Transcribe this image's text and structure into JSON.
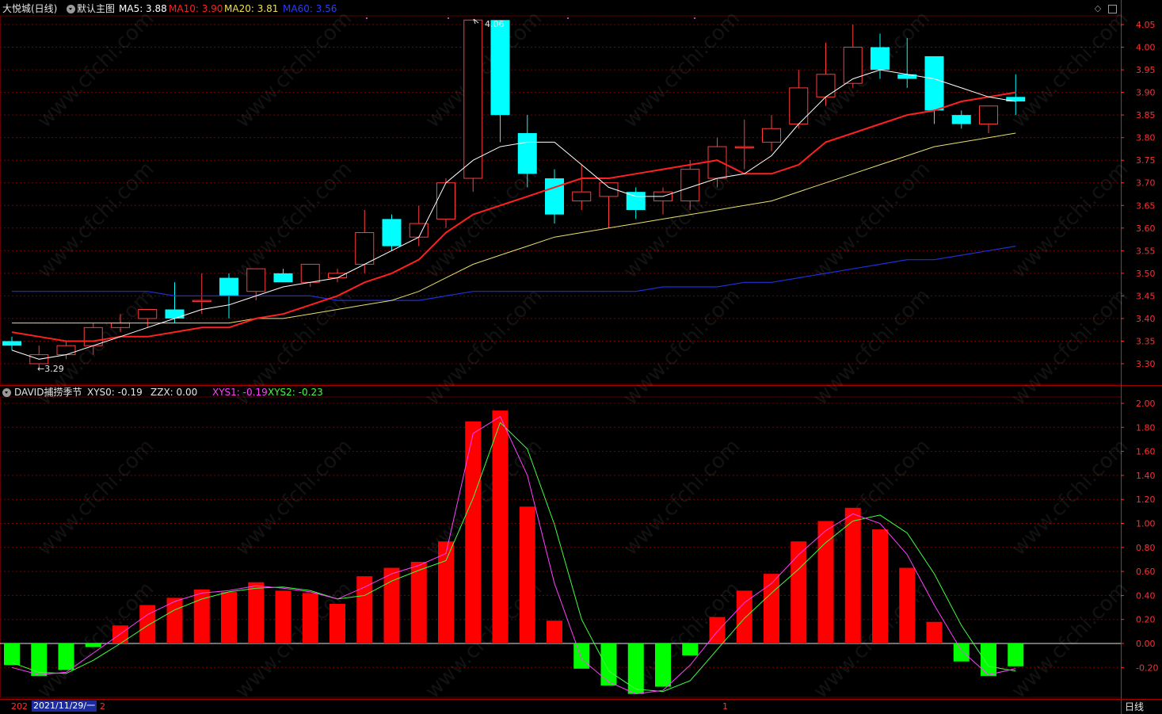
{
  "title_bar": {
    "stock_label": "大悦城(日线)",
    "main_chart_label": "默认主图",
    "ma5": "MA5: 3.88",
    "ma10": "MA10: 3.90",
    "ma20": "MA20: 3.81",
    "ma60": "MA60: 3.56"
  },
  "indicator_bar": {
    "name": "DAVID捕捞季节",
    "xys0": "XYS0: -0.19",
    "zzx": "ZZX: 0.00",
    "xys1": "XYS1: -0.19",
    "xys2": "XYS2: -0.23"
  },
  "annotations": {
    "low": "←3.29",
    "high": "4.06"
  },
  "bottom": {
    "left_year": "202",
    "date_cursor": "2021/11/29/一",
    "after_cursor": "2",
    "mid_marker": "1",
    "period_button": "日线"
  },
  "watermark": "www.cfchi.com",
  "colors": {
    "up": "#ff3c3c",
    "down": "#00ffff",
    "ma5": "#ffffff",
    "ma10": "#ff2020",
    "ma20": "#e8e070",
    "ma60": "#1f2fd8",
    "bar_up": "#ff0000",
    "bar_down": "#00ff00",
    "xys1": "#ff40ff",
    "xys2": "#40ff40",
    "grid": "#7a0000",
    "axis": "#ff3030"
  },
  "chart_data": [
    {
      "type": "candlestick",
      "price_axis_ticks": [
        "4.05",
        "4.00",
        "3.95",
        "3.90",
        "3.85",
        "3.80",
        "3.75",
        "3.70",
        "3.65",
        "3.60",
        "3.55",
        "3.50",
        "3.45",
        "3.40",
        "3.35",
        "3.30"
      ],
      "ylim": [
        3.25,
        4.07
      ],
      "candles": [
        {
          "o": 3.35,
          "h": 3.36,
          "l": 3.33,
          "c": 3.34
        },
        {
          "o": 3.3,
          "h": 3.34,
          "l": 3.29,
          "c": 3.32
        },
        {
          "o": 3.32,
          "h": 3.35,
          "l": 3.31,
          "c": 3.34
        },
        {
          "o": 3.34,
          "h": 3.39,
          "l": 3.32,
          "c": 3.38
        },
        {
          "o": 3.38,
          "h": 3.41,
          "l": 3.37,
          "c": 3.39
        },
        {
          "o": 3.4,
          "h": 3.42,
          "l": 3.38,
          "c": 3.42
        },
        {
          "o": 3.42,
          "h": 3.48,
          "l": 3.39,
          "c": 3.4
        },
        {
          "o": 3.44,
          "h": 3.5,
          "l": 3.41,
          "c": 3.44
        },
        {
          "o": 3.49,
          "h": 3.5,
          "l": 3.4,
          "c": 3.45
        },
        {
          "o": 3.46,
          "h": 3.51,
          "l": 3.44,
          "c": 3.51
        },
        {
          "o": 3.5,
          "h": 3.51,
          "l": 3.48,
          "c": 3.48
        },
        {
          "o": 3.48,
          "h": 3.52,
          "l": 3.47,
          "c": 3.52
        },
        {
          "o": 3.49,
          "h": 3.51,
          "l": 3.48,
          "c": 3.5
        },
        {
          "o": 3.52,
          "h": 3.64,
          "l": 3.5,
          "c": 3.59
        },
        {
          "o": 3.62,
          "h": 3.63,
          "l": 3.55,
          "c": 3.56
        },
        {
          "o": 3.58,
          "h": 3.65,
          "l": 3.56,
          "c": 3.61
        },
        {
          "o": 3.62,
          "h": 3.71,
          "l": 3.6,
          "c": 3.7
        },
        {
          "o": 3.71,
          "h": 4.06,
          "l": 3.68,
          "c": 4.06
        },
        {
          "o": 4.06,
          "h": 4.06,
          "l": 3.79,
          "c": 3.85
        },
        {
          "o": 3.81,
          "h": 3.85,
          "l": 3.69,
          "c": 3.72
        },
        {
          "o": 3.71,
          "h": 3.73,
          "l": 3.61,
          "c": 3.63
        },
        {
          "o": 3.66,
          "h": 3.74,
          "l": 3.64,
          "c": 3.68
        },
        {
          "o": 3.67,
          "h": 3.7,
          "l": 3.6,
          "c": 3.7
        },
        {
          "o": 3.68,
          "h": 3.69,
          "l": 3.62,
          "c": 3.64
        },
        {
          "o": 3.66,
          "h": 3.69,
          "l": 3.63,
          "c": 3.68
        },
        {
          "o": 3.66,
          "h": 3.75,
          "l": 3.64,
          "c": 3.73
        },
        {
          "o": 3.71,
          "h": 3.8,
          "l": 3.69,
          "c": 3.78
        },
        {
          "o": 3.78,
          "h": 3.84,
          "l": 3.73,
          "c": 3.78
        },
        {
          "o": 3.79,
          "h": 3.85,
          "l": 3.77,
          "c": 3.82
        },
        {
          "o": 3.83,
          "h": 3.95,
          "l": 3.82,
          "c": 3.91
        },
        {
          "o": 3.89,
          "h": 4.01,
          "l": 3.87,
          "c": 3.94
        },
        {
          "o": 3.92,
          "h": 4.05,
          "l": 3.91,
          "c": 4.0
        },
        {
          "o": 4.0,
          "h": 4.03,
          "l": 3.93,
          "c": 3.95
        },
        {
          "o": 3.94,
          "h": 4.02,
          "l": 3.91,
          "c": 3.93
        },
        {
          "o": 3.98,
          "h": 3.98,
          "l": 3.83,
          "c": 3.86
        },
        {
          "o": 3.85,
          "h": 3.86,
          "l": 3.82,
          "c": 3.83
        },
        {
          "o": 3.83,
          "h": 3.87,
          "l": 3.81,
          "c": 3.87
        },
        {
          "o": 3.89,
          "h": 3.94,
          "l": 3.85,
          "c": 3.88
        }
      ],
      "ma5": [
        3.33,
        3.31,
        3.32,
        3.34,
        3.36,
        3.38,
        3.4,
        3.42,
        3.43,
        3.45,
        3.47,
        3.48,
        3.49,
        3.52,
        3.55,
        3.58,
        3.7,
        3.75,
        3.78,
        3.79,
        3.79,
        3.74,
        3.69,
        3.67,
        3.67,
        3.69,
        3.71,
        3.72,
        3.76,
        3.83,
        3.89,
        3.93,
        3.95,
        3.94,
        3.93,
        3.91,
        3.89,
        3.88
      ],
      "ma10": [
        3.37,
        3.36,
        3.35,
        3.35,
        3.36,
        3.36,
        3.37,
        3.38,
        3.38,
        3.4,
        3.41,
        3.43,
        3.45,
        3.48,
        3.5,
        3.53,
        3.59,
        3.63,
        3.65,
        3.67,
        3.69,
        3.71,
        3.71,
        3.72,
        3.73,
        3.74,
        3.75,
        3.72,
        3.72,
        3.74,
        3.79,
        3.81,
        3.83,
        3.85,
        3.86,
        3.88,
        3.89,
        3.9
      ],
      "ma20": [
        3.39,
        3.39,
        3.39,
        3.39,
        3.39,
        3.39,
        3.39,
        3.39,
        3.39,
        3.4,
        3.4,
        3.41,
        3.42,
        3.43,
        3.44,
        3.46,
        3.49,
        3.52,
        3.54,
        3.56,
        3.58,
        3.59,
        3.6,
        3.61,
        3.62,
        3.63,
        3.64,
        3.65,
        3.66,
        3.68,
        3.7,
        3.72,
        3.74,
        3.76,
        3.78,
        3.79,
        3.8,
        3.81
      ],
      "ma60": [
        3.46,
        3.46,
        3.46,
        3.46,
        3.46,
        3.46,
        3.45,
        3.45,
        3.45,
        3.45,
        3.45,
        3.45,
        3.44,
        3.44,
        3.44,
        3.44,
        3.45,
        3.46,
        3.46,
        3.46,
        3.46,
        3.46,
        3.46,
        3.46,
        3.47,
        3.47,
        3.47,
        3.48,
        3.48,
        3.49,
        3.5,
        3.51,
        3.52,
        3.53,
        3.53,
        3.54,
        3.55,
        3.56
      ]
    },
    {
      "type": "bar",
      "name": "DAVID捕捞季节",
      "value_axis_ticks": [
        "2.00",
        "1.80",
        "1.60",
        "1.40",
        "1.20",
        "1.00",
        "0.80",
        "0.60",
        "0.40",
        "0.20",
        "0.00",
        "-0.20"
      ],
      "ylim": [
        -0.48,
        2.07
      ],
      "xys0": [
        -0.18,
        -0.27,
        -0.22,
        -0.03,
        0.15,
        0.32,
        0.38,
        0.45,
        0.43,
        0.51,
        0.44,
        0.42,
        0.33,
        0.56,
        0.63,
        0.68,
        0.85,
        1.85,
        1.94,
        1.14,
        0.19,
        -0.21,
        -0.35,
        -0.42,
        -0.36,
        -0.1,
        0.22,
        0.44,
        0.58,
        0.85,
        1.02,
        1.13,
        0.95,
        0.63,
        0.18,
        -0.15,
        -0.27,
        -0.19
      ],
      "xys1": [
        -0.2,
        -0.26,
        -0.24,
        -0.08,
        0.08,
        0.24,
        0.35,
        0.42,
        0.44,
        0.48,
        0.46,
        0.43,
        0.37,
        0.47,
        0.58,
        0.65,
        0.75,
        1.75,
        1.89,
        1.4,
        0.5,
        -0.13,
        -0.32,
        -0.42,
        -0.39,
        -0.18,
        0.1,
        0.34,
        0.5,
        0.74,
        0.94,
        1.08,
        1.0,
        0.74,
        0.32,
        -0.06,
        -0.26,
        -0.21
      ],
      "xys2": [
        -0.16,
        -0.24,
        -0.25,
        -0.14,
        0.0,
        0.15,
        0.28,
        0.37,
        0.43,
        0.46,
        0.47,
        0.44,
        0.37,
        0.4,
        0.52,
        0.61,
        0.69,
        1.21,
        1.84,
        1.62,
        0.99,
        0.2,
        -0.23,
        -0.38,
        -0.4,
        -0.31,
        -0.05,
        0.21,
        0.42,
        0.62,
        0.84,
        1.02,
        1.07,
        0.92,
        0.58,
        0.15,
        -0.19,
        -0.23
      ]
    }
  ]
}
